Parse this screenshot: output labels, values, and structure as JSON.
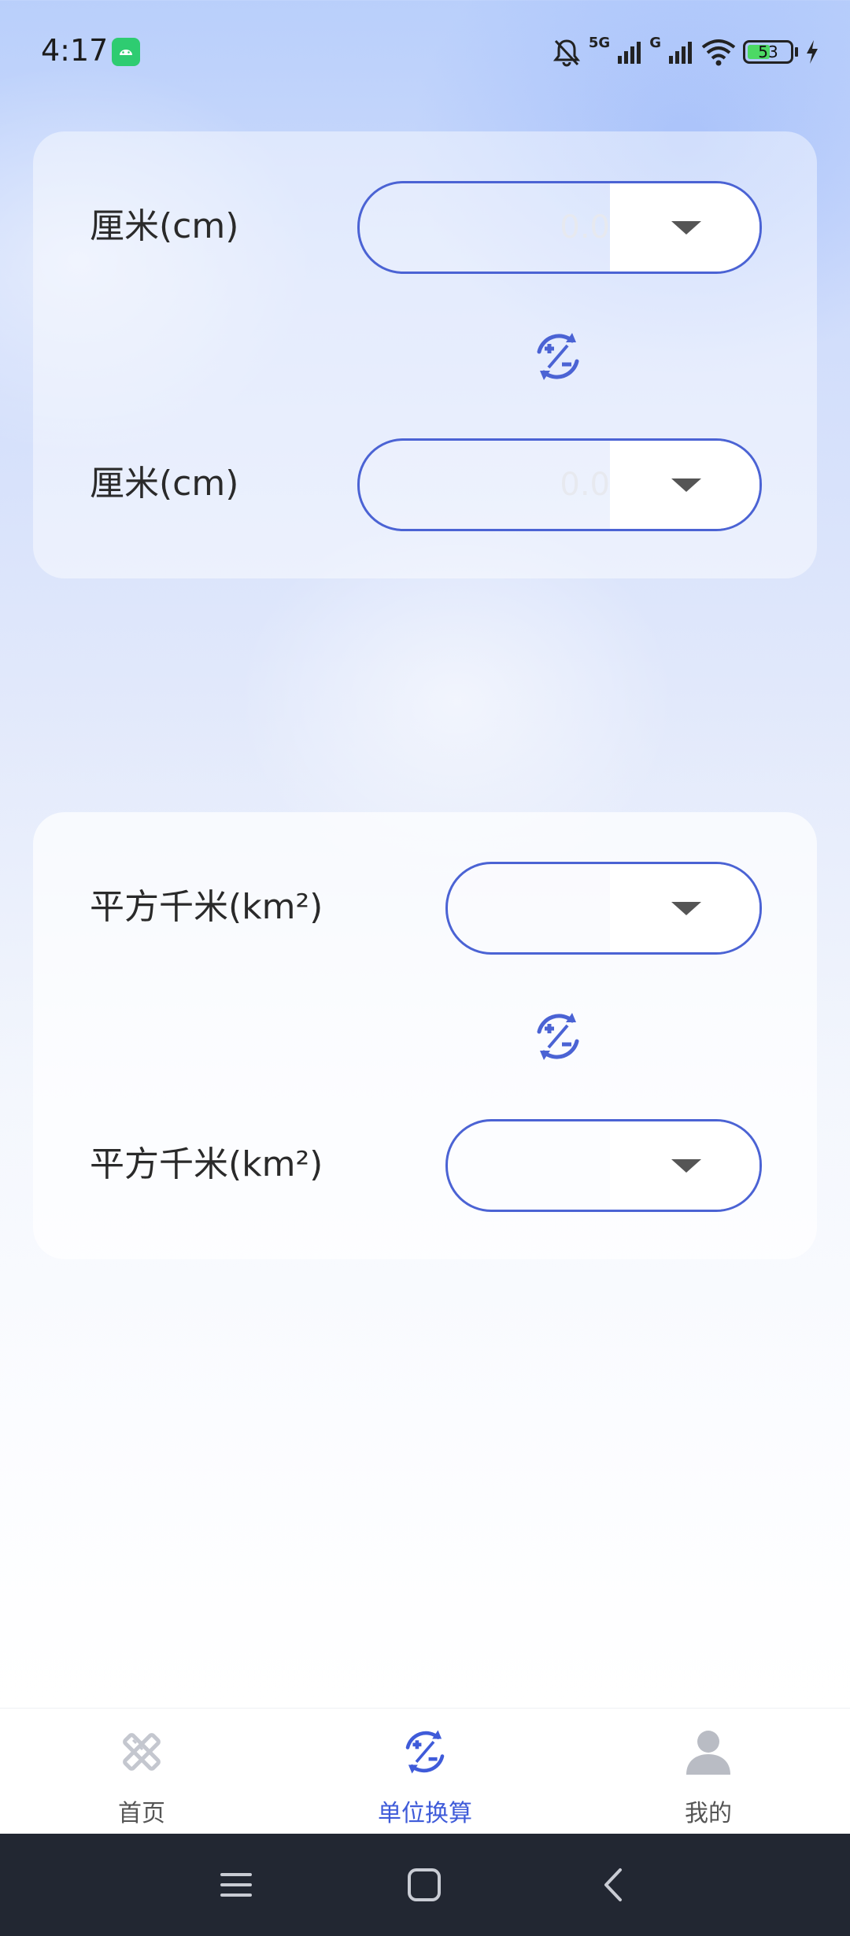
{
  "status_bar": {
    "time": "4:17",
    "network_1": "5G",
    "network_2": "G",
    "battery": "53"
  },
  "converters": [
    {
      "from": {
        "unit_label": "厘米(cm)",
        "value": "0.0"
      },
      "to": {
        "unit_label": "厘米(cm)",
        "value": "0.0"
      },
      "swap_icon": "swap-convert-icon"
    },
    {
      "from": {
        "unit_label": "平方千米(km²)",
        "value": ""
      },
      "to": {
        "unit_label": "平方千米(km²)",
        "value": ""
      },
      "swap_icon": "swap-convert-icon"
    }
  ],
  "tab_bar": {
    "tabs": [
      {
        "label": "首页",
        "icon": "tools-icon",
        "active": false
      },
      {
        "label": "单位换算",
        "icon": "unit-convert-icon",
        "active": true
      },
      {
        "label": "我的",
        "icon": "user-icon",
        "active": false
      }
    ]
  },
  "colors": {
    "accent": "#4b63d4",
    "active_tab": "#3f5bd9",
    "nav_bar": "#222732"
  }
}
